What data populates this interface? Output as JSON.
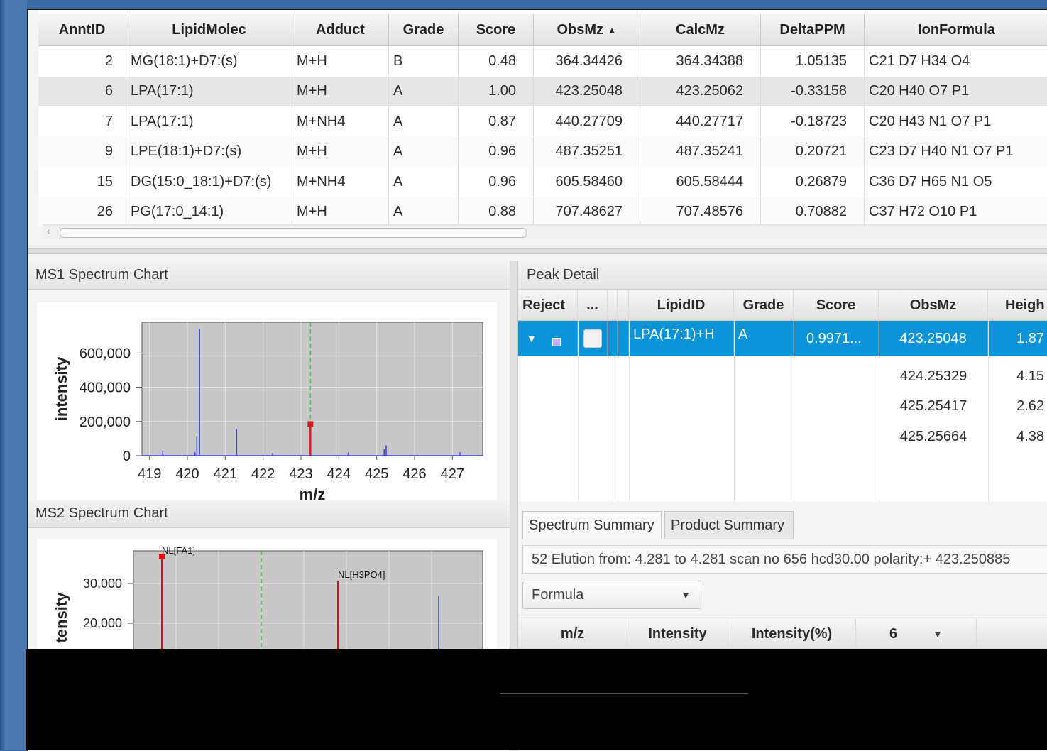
{
  "annot_table": {
    "columns": [
      "AnntID",
      "LipidMolec",
      "Adduct",
      "Grade",
      "Score",
      "ObsMz",
      "CalcMz",
      "DeltaPPM",
      "IonFormula"
    ],
    "sort_indicator": "▲",
    "rows": [
      [
        "2",
        "MG(18:1)+D7:(s)",
        "M+H",
        "B",
        "0.48",
        "364.34426",
        "364.34388",
        "1.05135",
        "C21 D7 H34 O4"
      ],
      [
        "6",
        "LPA(17:1)",
        "M+H",
        "A",
        "1.00",
        "423.25048",
        "423.25062",
        "-0.33158",
        "C20 H40 O7 P1"
      ],
      [
        "7",
        "LPA(17:1)",
        "M+NH4",
        "A",
        "0.87",
        "440.27709",
        "440.27717",
        "-0.18723",
        "C20 H43 N1 O7 P1"
      ],
      [
        "9",
        "LPE(18:1)+D7:(s)",
        "M+H",
        "A",
        "0.96",
        "487.35251",
        "487.35241",
        "0.20721",
        "C23 D7 H40 N1 O7 P1"
      ],
      [
        "15",
        "DG(15:0_18:1)+D7:(s)",
        "M+NH4",
        "A",
        "0.96",
        "605.58460",
        "605.58444",
        "0.26879",
        "C36 D7 H65 N1 O5"
      ],
      [
        "26",
        "PG(17:0_14:1)",
        "M+H",
        "A",
        "0.88",
        "707.48627",
        "707.48576",
        "0.70882",
        "C37 H72 O10 P1"
      ]
    ],
    "selected_row": 1
  },
  "ms1": {
    "title": "MS1 Spectrum Chart",
    "chart_data": {
      "type": "bar",
      "xlabel": "m/z",
      "ylabel": "intensity",
      "xlim": [
        418.8,
        427.8
      ],
      "ylim": [
        0,
        780000
      ],
      "xticks": [
        "419",
        "420",
        "421",
        "422",
        "423",
        "424",
        "425",
        "426",
        "427"
      ],
      "yticks": [
        "0",
        "200,000",
        "400,000",
        "600,000"
      ],
      "peaks": [
        {
          "x": 419.35,
          "y": 30000
        },
        {
          "x": 420.2,
          "y": 20000
        },
        {
          "x": 420.25,
          "y": 115000
        },
        {
          "x": 420.32,
          "y": 740000
        },
        {
          "x": 421.3,
          "y": 155000
        },
        {
          "x": 422.25,
          "y": 15000
        },
        {
          "x": 424.25,
          "y": 20000
        },
        {
          "x": 425.2,
          "y": 40000
        },
        {
          "x": 425.25,
          "y": 60000
        },
        {
          "x": 427.2,
          "y": 20000
        }
      ],
      "highlight_peak": {
        "x": 423.25,
        "y": 185000,
        "color": "#d22020"
      },
      "marker_line_x": 423.25
    }
  },
  "ms2": {
    "title": "MS2 Spectrum Chart",
    "chart_data": {
      "type": "bar",
      "ylabel": "tensity",
      "yticks": [
        "20,000",
        "30,000"
      ],
      "annotations": [
        "NL[FA1]",
        "NL[H3PO4]"
      ]
    }
  },
  "peak_detail": {
    "title": "Peak Detail",
    "columns": [
      "Reject",
      "...",
      "",
      "LipidID",
      "Grade",
      "Score",
      "ObsMz",
      "Heigh"
    ],
    "selected": {
      "lipid": "LPA(17:1)+H",
      "grade": "A",
      "score": "0.9971...",
      "obsmz": "423.25048",
      "height": "1.87"
    },
    "isotopes": [
      {
        "obsmz": "424.25329",
        "height": "4.15"
      },
      {
        "obsmz": "425.25417",
        "height": "2.62"
      },
      {
        "obsmz": "425.25664",
        "height": "4.38"
      }
    ],
    "tabs": [
      "Spectrum Summary",
      "Product Summary"
    ],
    "summary": "52 Elution from: 4.281 to 4.281 scan no 656 hcd30.00 polarity:+ 423.250885",
    "combo_value": "Formula",
    "ms_columns": [
      "m/z",
      "Intensity",
      "Intensity(%)",
      "6"
    ]
  }
}
